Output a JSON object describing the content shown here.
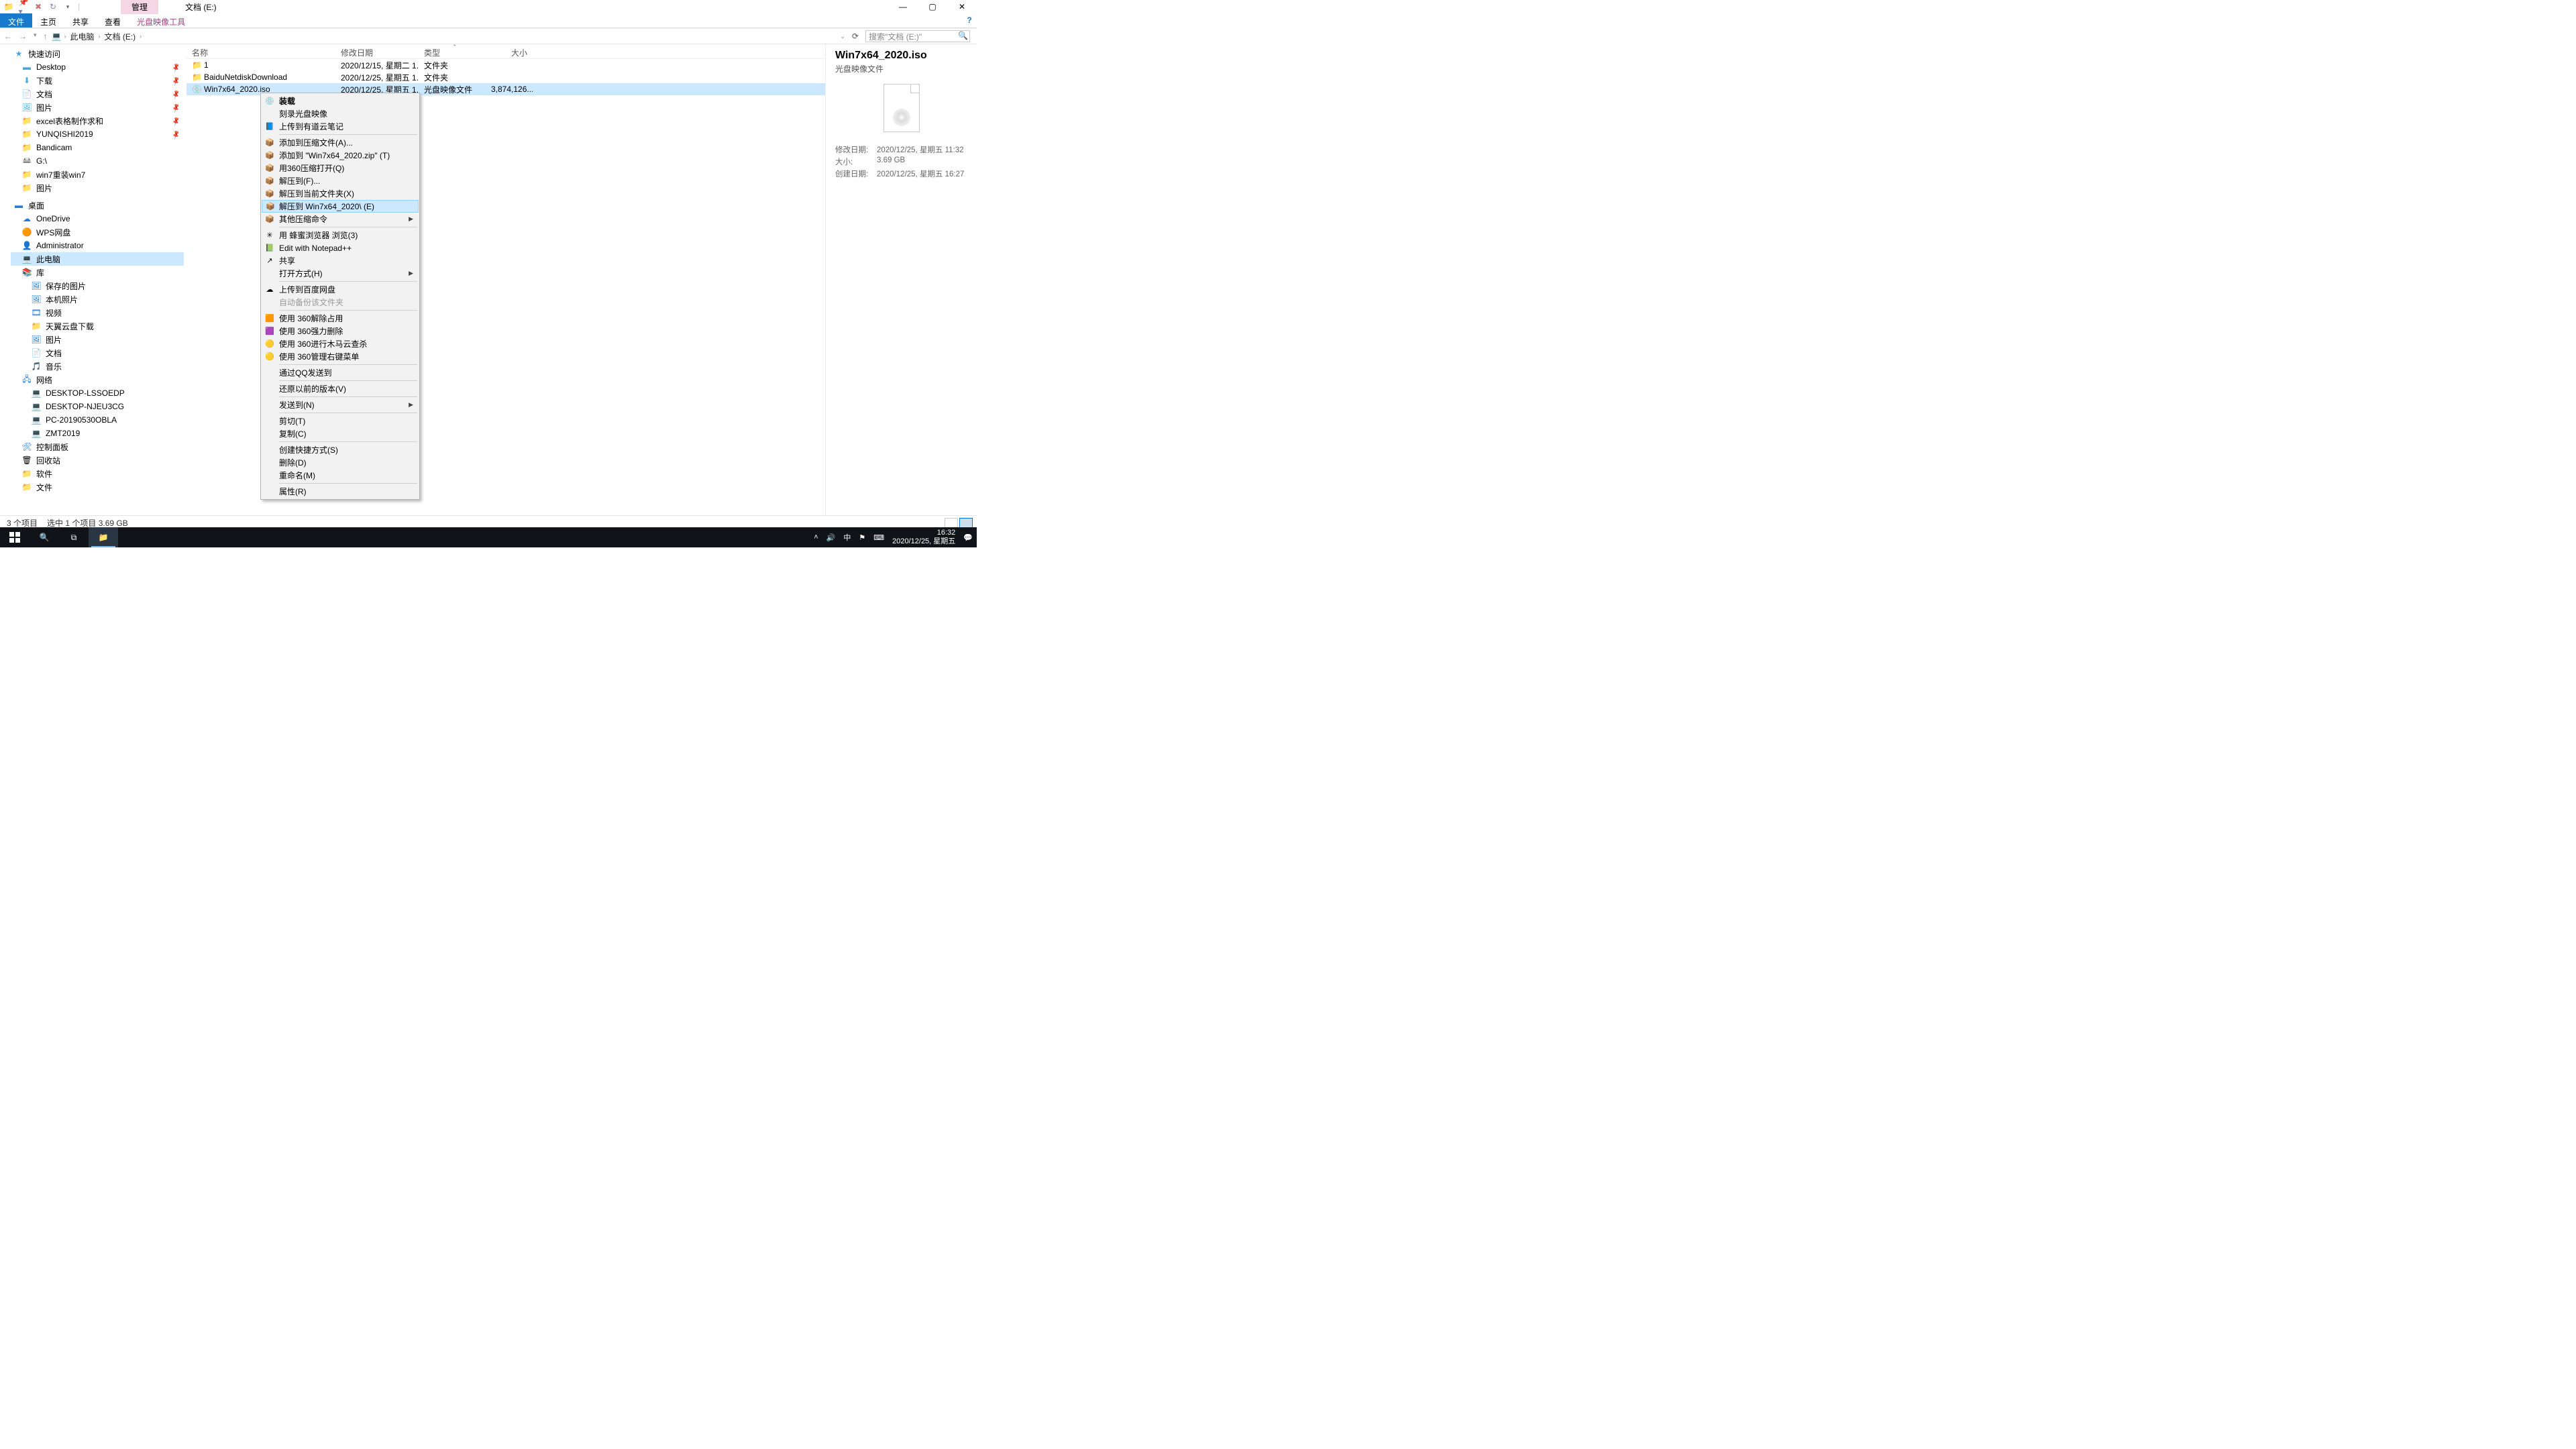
{
  "titlebar": {
    "tab_manage": "管理",
    "tab_drive": "文档 (E:)"
  },
  "ribbon": {
    "file": "文件",
    "home": "主页",
    "share": "共享",
    "view": "查看",
    "tools": "光盘映像工具"
  },
  "breadcrumb": {
    "root": "此电脑",
    "drive": "文档 (E:)"
  },
  "search": {
    "placeholder": "搜索\"文档 (E:)\""
  },
  "tree": {
    "quick": "快速访问",
    "desktop": "Desktop",
    "downloads": "下载",
    "documents": "文档",
    "pictures": "图片",
    "excel": "excel表格制作求和",
    "yunqishi": "YUNQISHI2019",
    "bandicam": "Bandicam",
    "gdrive": "G:\\",
    "win7re": "win7重装win7",
    "pics2": "图片",
    "desktop_zh": "桌面",
    "onedrive": "OneDrive",
    "wps": "WPS网盘",
    "admin": "Administrator",
    "thispc": "此电脑",
    "library": "库",
    "savedpics": "保存的图片",
    "localpics": "本机照片",
    "video": "视频",
    "tianyi": "天翼云盘下载",
    "pictures2": "图片",
    "docs2": "文档",
    "music": "音乐",
    "network": "网络",
    "pc1": "DESKTOP-LSSOEDP",
    "pc2": "DESKTOP-NJEU3CG",
    "pc3": "PC-20190530OBLA",
    "pc4": "ZMT2019",
    "ctrlpanel": "控制面板",
    "recycle": "回收站",
    "soft": "软件",
    "files": "文件"
  },
  "columns": {
    "name": "名称",
    "date": "修改日期",
    "type": "类型",
    "size": "大小"
  },
  "rows": [
    {
      "icon": "folder",
      "name": "1",
      "date": "2020/12/15, 星期二 1...",
      "type": "文件夹",
      "size": ""
    },
    {
      "icon": "folder",
      "name": "BaiduNetdiskDownload",
      "date": "2020/12/25, 星期五 1...",
      "type": "文件夹",
      "size": ""
    },
    {
      "icon": "iso",
      "name": "Win7x64_2020.iso",
      "date": "2020/12/25, 星期五 1...",
      "type": "光盘映像文件",
      "size": "3,874,126..."
    }
  ],
  "preview": {
    "title": "Win7x64_2020.iso",
    "sub": "光盘映像文件",
    "k_modified": "修改日期:",
    "v_modified": "2020/12/25, 星期五 11:32",
    "k_size": "大小:",
    "v_size": "3.69 GB",
    "k_created": "创建日期:",
    "v_created": "2020/12/25, 星期五 16:27"
  },
  "context": [
    {
      "label": "装载",
      "icon": "💿",
      "bold": true
    },
    {
      "label": "刻录光盘映像"
    },
    {
      "label": "上传到有道云笔记",
      "icon": "📘"
    },
    {
      "sep": true
    },
    {
      "label": "添加到压缩文件(A)...",
      "icon": "📦"
    },
    {
      "label": "添加到 \"Win7x64_2020.zip\" (T)",
      "icon": "📦"
    },
    {
      "label": "用360压缩打开(Q)",
      "icon": "📦"
    },
    {
      "label": "解压到(F)...",
      "icon": "📦"
    },
    {
      "label": "解压到当前文件夹(X)",
      "icon": "📦"
    },
    {
      "label": "解压到 Win7x64_2020\\ (E)",
      "icon": "📦",
      "hover": true
    },
    {
      "label": "其他压缩命令",
      "icon": "📦",
      "arrow": true
    },
    {
      "sep": true
    },
    {
      "label": "用 蜂蜜浏览器 浏览(3)",
      "icon": "✳"
    },
    {
      "label": "Edit with Notepad++",
      "icon": "📗"
    },
    {
      "label": "共享",
      "icon": "↗"
    },
    {
      "label": "打开方式(H)",
      "arrow": true
    },
    {
      "sep": true
    },
    {
      "label": "上传到百度网盘",
      "icon": "☁"
    },
    {
      "label": "自动备份该文件夹",
      "disabled": true
    },
    {
      "sep": true
    },
    {
      "label": "使用 360解除占用",
      "icon": "🟧"
    },
    {
      "label": "使用 360强力删除",
      "icon": "🟪"
    },
    {
      "label": "使用 360进行木马云查杀",
      "icon": "🟡"
    },
    {
      "label": "使用 360管理右键菜单",
      "icon": "🟡"
    },
    {
      "sep": true
    },
    {
      "label": "通过QQ发送到"
    },
    {
      "sep": true
    },
    {
      "label": "还原以前的版本(V)"
    },
    {
      "sep": true
    },
    {
      "label": "发送到(N)",
      "arrow": true
    },
    {
      "sep": true
    },
    {
      "label": "剪切(T)"
    },
    {
      "label": "复制(C)"
    },
    {
      "sep": true
    },
    {
      "label": "创建快捷方式(S)"
    },
    {
      "label": "删除(D)"
    },
    {
      "label": "重命名(M)"
    },
    {
      "sep": true
    },
    {
      "label": "属性(R)"
    }
  ],
  "status": {
    "count": "3 个项目",
    "sel": "选中 1 个项目  3.69 GB"
  },
  "taskbar": {
    "ime": "中",
    "time": "16:32",
    "date": "2020/12/25, 星期五"
  }
}
